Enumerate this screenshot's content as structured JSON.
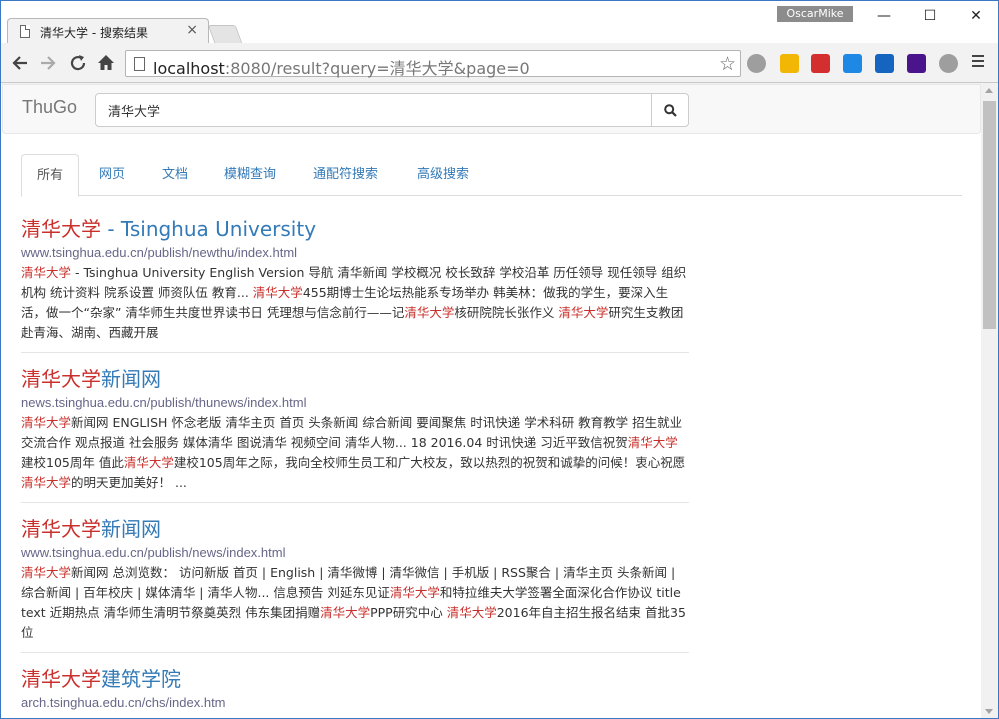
{
  "browser": {
    "tab_title": "清华大学 - 搜索结果",
    "tab_close": "×",
    "profile_name": "OscarMike",
    "win_min": "—",
    "win_max": "☐",
    "win_close": "✕",
    "url_host": "localhost",
    "url_rest": ":8080/result?query=清华大学&page=0",
    "icons": [
      "back-arrow-icon",
      "forward-arrow-icon",
      "reload-icon",
      "home-icon",
      "star-icon",
      "menu-icon"
    ],
    "extensions": [
      {
        "name": "globe-extension-icon",
        "color": "#9e9e9e"
      },
      {
        "name": "dots-extension-icon",
        "color": "#f2b705"
      },
      {
        "name": "adblock-extension-icon",
        "color": "#d32f2f"
      },
      {
        "name": "play-extension-icon",
        "color": "#1e88e5"
      },
      {
        "name": "diamond-extension-icon",
        "color": "#1565c0"
      },
      {
        "name": "check-extension-icon",
        "color": "#4a148c"
      },
      {
        "name": "download-extension-icon",
        "color": "#9e9e9e"
      }
    ]
  },
  "app": {
    "brand": "ThuGo",
    "query": "清华大学",
    "tabs": [
      {
        "label": "所有",
        "active": true
      },
      {
        "label": "网页",
        "active": false
      },
      {
        "label": "文档",
        "active": false
      },
      {
        "label": "模糊查询",
        "active": false
      },
      {
        "label": "通配符搜索",
        "active": false
      },
      {
        "label": "高级搜索",
        "active": false
      }
    ]
  },
  "colors": {
    "link": "#337ab7",
    "highlight": "#c9302c",
    "url": "#666688"
  },
  "results": [
    {
      "title": [
        {
          "t": "清华大学",
          "hl": true
        },
        {
          "t": " - Tsinghua University",
          "hl": false
        }
      ],
      "url": "www.tsinghua.edu.cn/publish/newthu/index.html",
      "snippet": [
        {
          "t": "清华大学",
          "hl": true
        },
        {
          "t": " - Tsinghua University English Version 导航 清华新闻 学校概况 校长致辞 学校沿革 历任领导 现任领导 组织机构 统计资料 院系设置 师资队伍 教育... ",
          "hl": false
        },
        {
          "t": "清华大学",
          "hl": true
        },
        {
          "t": "455期博士生论坛热能系专场举办 韩美林：做我的学生，要深入生活，做一个“杂家” 清华师生共度世界读书日 凭理想与信念前行——记",
          "hl": false
        },
        {
          "t": "清华大学",
          "hl": true
        },
        {
          "t": "核研院院长张作义 ",
          "hl": false
        },
        {
          "t": "清华大学",
          "hl": true
        },
        {
          "t": "研究生支教团赴青海、湖南、西藏开展",
          "hl": false
        }
      ]
    },
    {
      "title": [
        {
          "t": "清华大学",
          "hl": true
        },
        {
          "t": "新闻网",
          "hl": false
        }
      ],
      "url": "news.tsinghua.edu.cn/publish/thunews/index.html",
      "snippet": [
        {
          "t": "清华大学",
          "hl": true
        },
        {
          "t": "新闻网 ENGLISH 怀念老版 清华主页 首页 头条新闻 综合新闻 要闻聚焦 时讯快递 学术科研 教育教学 招生就业 交流合作 观点报道 社会服务 媒体清华 图说清华 视频空间 清华人物... 18 2016.04 时讯快递 习近平致信祝贺",
          "hl": false
        },
        {
          "t": "清华大学",
          "hl": true
        },
        {
          "t": "建校105周年 值此",
          "hl": false
        },
        {
          "t": "清华大学",
          "hl": true
        },
        {
          "t": "建校105周年之际，我向全校师生员工和广大校友，致以热烈的祝贺和诚挚的问候！衷心祝愿",
          "hl": false
        },
        {
          "t": "清华大学",
          "hl": true
        },
        {
          "t": "的明天更加美好！ ...",
          "hl": false
        }
      ]
    },
    {
      "title": [
        {
          "t": "清华大学",
          "hl": true
        },
        {
          "t": "新闻网",
          "hl": false
        }
      ],
      "url": "www.tsinghua.edu.cn/publish/news/index.html",
      "snippet": [
        {
          "t": "清华大学",
          "hl": true
        },
        {
          "t": "新闻网 总浏览数： 访问新版 首页 | English | 清华微博 | 清华微信 | 手机版 | RSS聚合 | 清华主页 头条新闻 | 综合新闻 | 百年校庆 | 媒体清华 | 清华人物... 信息预告 刘延东见证",
          "hl": false
        },
        {
          "t": "清华大学",
          "hl": true
        },
        {
          "t": "和特拉维夫大学签署全面深化合作协议 title text 近期热点 清华师生清明节祭奠英烈 伟东集团捐赠",
          "hl": false
        },
        {
          "t": "清华大学",
          "hl": true
        },
        {
          "t": "PPP研究中心 ",
          "hl": false
        },
        {
          "t": "清华大学",
          "hl": true
        },
        {
          "t": "2016年自主招生报名结束 首批35位",
          "hl": false
        }
      ]
    },
    {
      "title": [
        {
          "t": "清华大学",
          "hl": true
        },
        {
          "t": "建筑学院",
          "hl": false
        }
      ],
      "url": "arch.tsinghua.edu.cn/chs/index.htm",
      "snippet": []
    }
  ]
}
